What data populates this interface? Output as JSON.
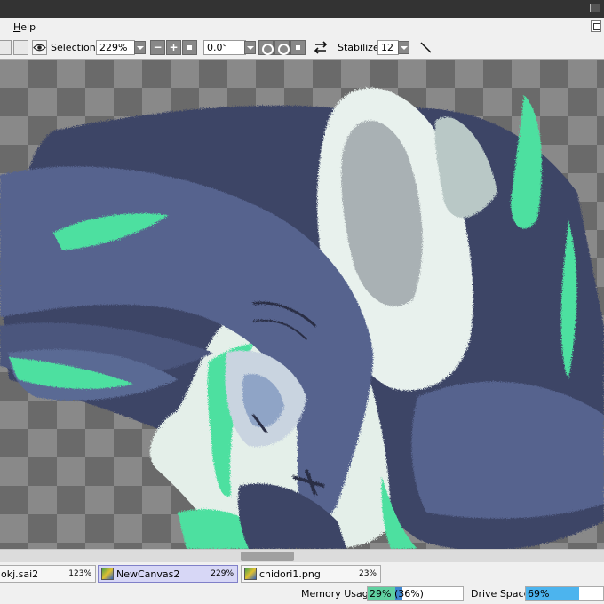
{
  "menu": {
    "help_label": "Help"
  },
  "toolbar": {
    "selection_label": "Selection",
    "zoom_value": "229%",
    "zoom_minus": "−",
    "zoom_plus": "+",
    "rotation_value": "0.0°",
    "stabilizer_label": "Stabilizer",
    "stabilizer_value": "12"
  },
  "tabs": [
    {
      "name": "okj.sai2",
      "zoom": "123%"
    },
    {
      "name": "NewCanvas2",
      "zoom": "229%",
      "active": true
    },
    {
      "name": "chidori1.png",
      "zoom": "23%"
    }
  ],
  "status": {
    "memory_label": "Memory Usage",
    "memory_value": "29% (36%)",
    "memory_fraction": 0.29,
    "memory_peak_fraction": 0.36,
    "drive_label": "Drive Space",
    "drive_value": "69%",
    "drive_fraction": 0.69
  },
  "colors": {
    "hair_dark": "#3d4466",
    "hair_blue": "#56648e",
    "hair_mint": "#4ee0a0",
    "face": "#e4efe9",
    "memory_fill": "#5fd0a0",
    "drive_fill": "#4cb4ee"
  }
}
